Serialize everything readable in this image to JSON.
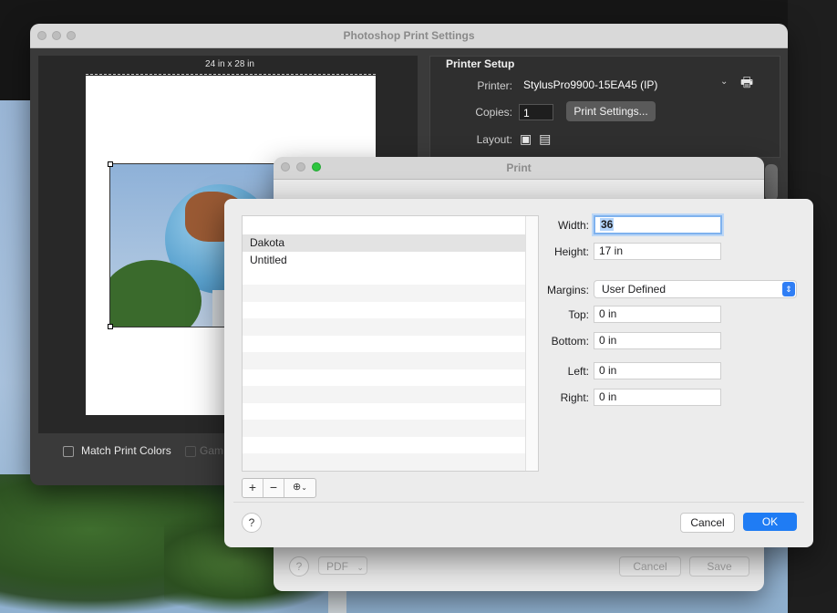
{
  "photoshop": {
    "title": "Photoshop Print Settings",
    "paper_size_label": "24 in x 28 in",
    "printer_setup": {
      "header": "Printer Setup",
      "printer_label": "Printer:",
      "printer_value": "StylusPro9900-15EA45 (IP)",
      "copies_label": "Copies:",
      "copies_value": "1",
      "print_settings_button": "Print Settings...",
      "layout_label": "Layout:"
    },
    "match_print_colors_label": "Match Print Colors",
    "gamut_label": "Gam"
  },
  "print_dialog": {
    "title": "Print",
    "help_label": "?",
    "pdf_label": "PDF",
    "cancel_label": "Cancel",
    "save_label": "Save"
  },
  "custom_sizes": {
    "list_items": [
      "Dakota",
      "Untitled"
    ],
    "add_label": "+",
    "remove_label": "−",
    "width_label": "Width:",
    "width_value": "36",
    "height_label": "Height:",
    "height_value": "17 in",
    "margins_label": "Margins:",
    "margins_value": "User Defined",
    "top_label": "Top:",
    "top_value": "0 in",
    "bottom_label": "Bottom:",
    "bottom_value": "0 in",
    "left_label": "Left:",
    "left_value": "0 in",
    "right_label": "Right:",
    "right_value": "0 in",
    "help_label": "?",
    "cancel_label": "Cancel",
    "ok_label": "OK"
  },
  "colors": {
    "accent": "#1f7cf4",
    "selected_row": "#e3e3e3"
  }
}
